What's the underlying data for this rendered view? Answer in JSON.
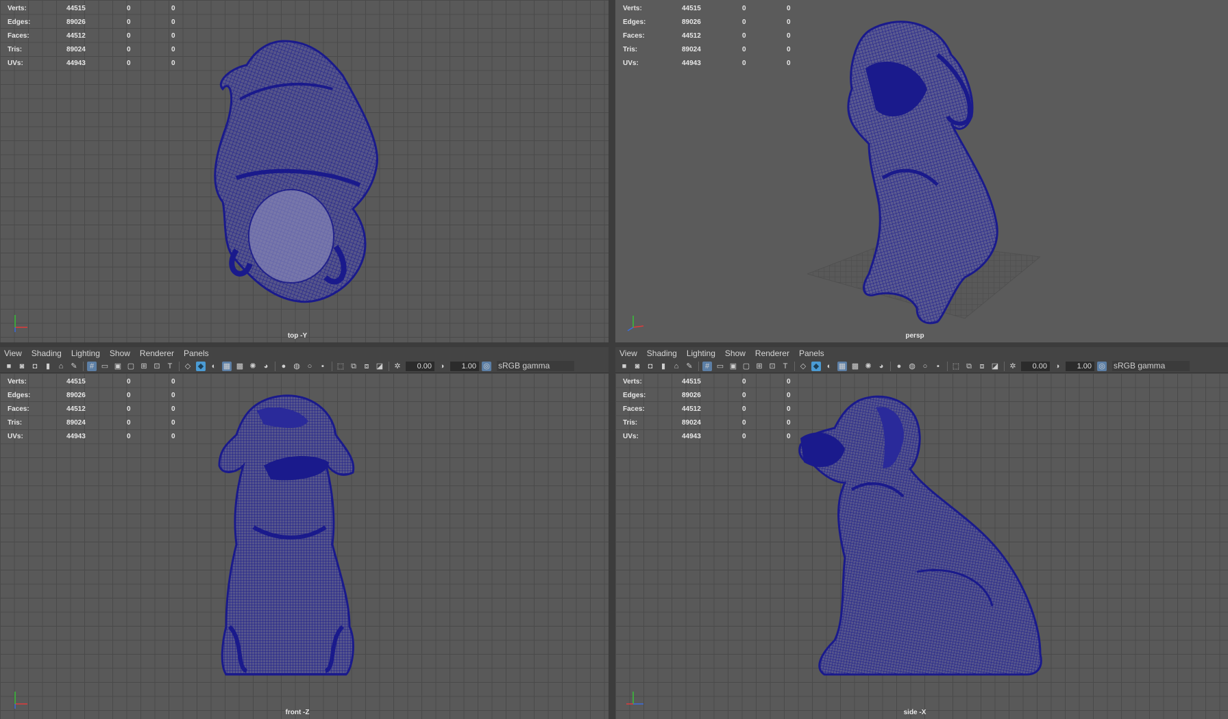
{
  "stats": {
    "rows": [
      {
        "label": "Verts:",
        "value": "44515",
        "a": "0",
        "b": "0"
      },
      {
        "label": "Edges:",
        "value": "89026",
        "a": "0",
        "b": "0"
      },
      {
        "label": "Faces:",
        "value": "44512",
        "a": "0",
        "b": "0"
      },
      {
        "label": "Tris:",
        "value": "89024",
        "a": "0",
        "b": "0"
      },
      {
        "label": "UVs:",
        "value": "44943",
        "a": "0",
        "b": "0"
      }
    ]
  },
  "viewports": {
    "top": {
      "camera": "top -Y"
    },
    "persp": {
      "camera": "persp"
    },
    "front": {
      "camera": "front -Z"
    },
    "side": {
      "camera": "side -X"
    }
  },
  "panel_menu": [
    "View",
    "Shading",
    "Lighting",
    "Show",
    "Renderer",
    "Panels"
  ],
  "toolbar": {
    "exposure": "0.00",
    "gamma": "1.00",
    "color_space": "sRGB gamma"
  },
  "colors": {
    "mesh_wire": "#1a1a8c",
    "grid_bg": "#595959",
    "panel_bg": "#444444"
  },
  "icons": [
    "camera-icon",
    "lock-icon",
    "bookmark-icon",
    "grid-icon",
    "wireframe-icon",
    "smooth-shade-icon",
    "xray-icon",
    "exposure-icon",
    "gamma-icon",
    "color-mgmt-icon"
  ]
}
